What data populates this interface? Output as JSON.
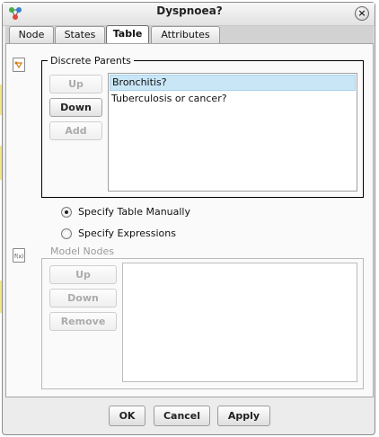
{
  "window": {
    "title": "Dyspnoea?",
    "close_glyph": "×"
  },
  "tabs": [
    {
      "label": "Node"
    },
    {
      "label": "States"
    },
    {
      "label": "Table",
      "active": true
    },
    {
      "label": "Attributes"
    }
  ],
  "discrete_parents": {
    "legend": "Discrete Parents",
    "icon": "discrete-parents-icon",
    "buttons": {
      "up": "Up",
      "down": "Down",
      "add": "Add"
    },
    "items": [
      "Bronchitis?",
      "Tuberculosis or cancer?"
    ],
    "selected_index": 0
  },
  "table_mode": {
    "options": [
      {
        "label": "Specify Table Manually",
        "checked": true
      },
      {
        "label": "Specify Expressions",
        "checked": false
      }
    ]
  },
  "model_nodes": {
    "legend": "Model Nodes",
    "icon": "model-nodes-icon",
    "buttons": {
      "up": "Up",
      "down": "Down",
      "remove": "Remove"
    },
    "items": []
  },
  "footer": {
    "ok": "OK",
    "cancel": "Cancel",
    "apply": "Apply"
  },
  "colors": {
    "selection": "#c9e6f7",
    "background": "#ececec"
  }
}
